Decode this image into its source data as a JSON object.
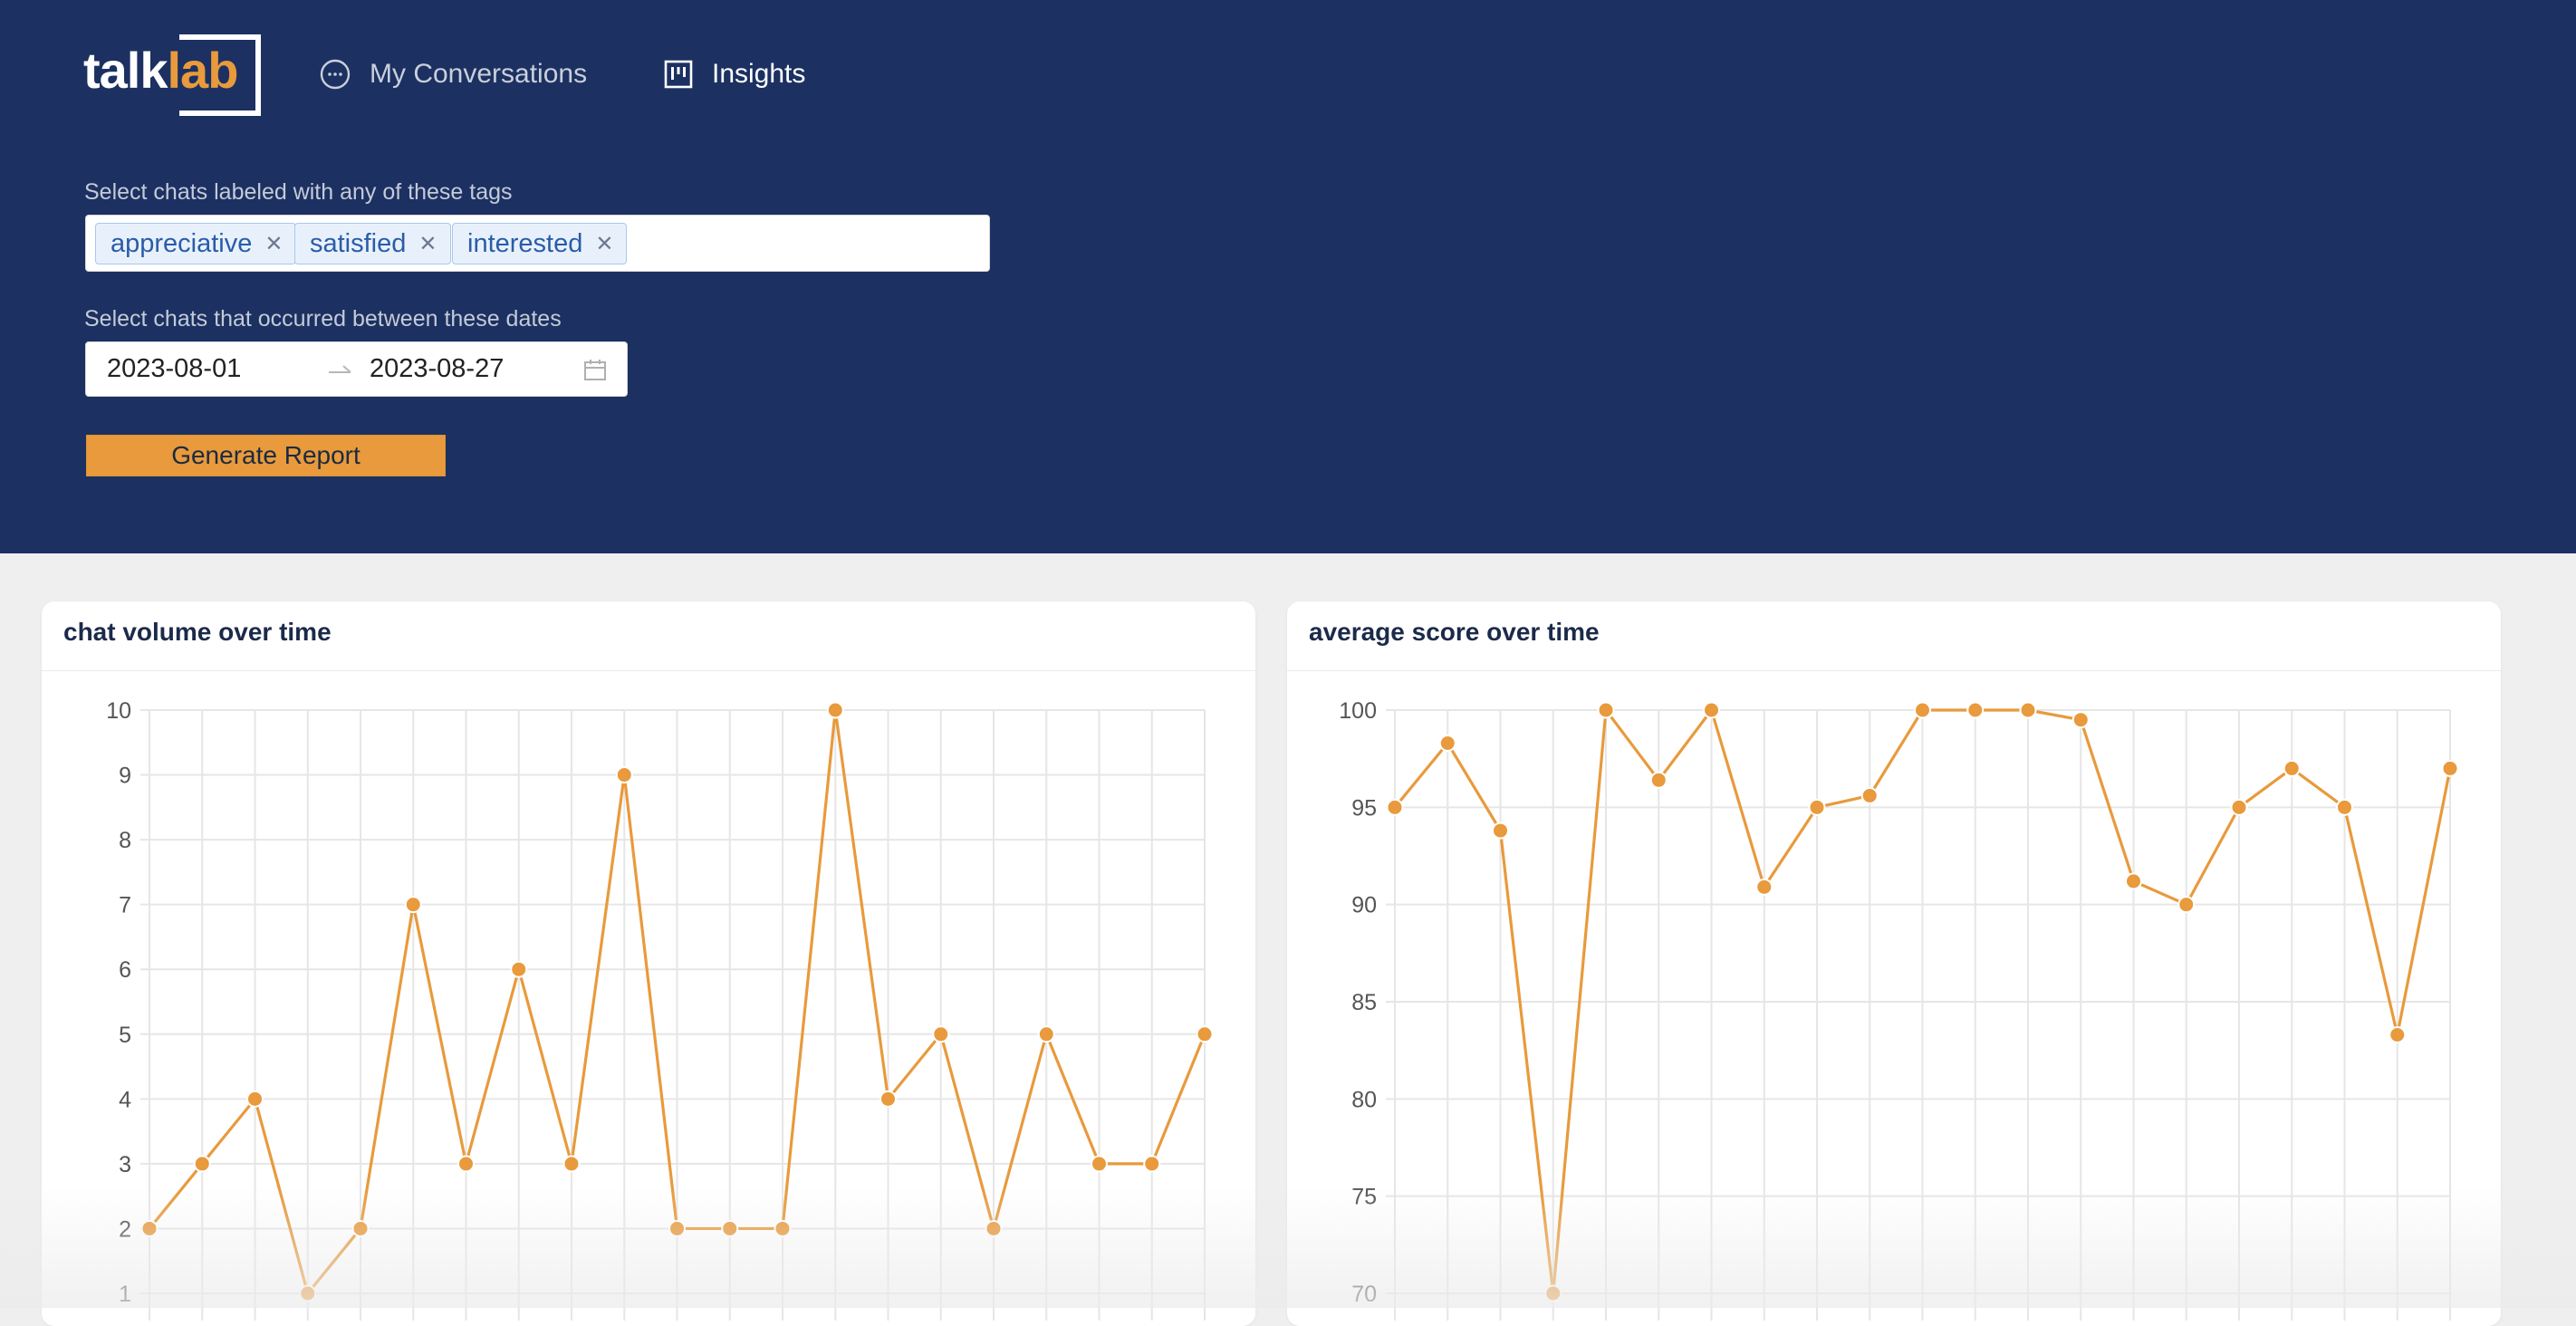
{
  "app": {
    "logo_talk": "talk",
    "logo_lab": "lab"
  },
  "nav": {
    "conversations": "My Conversations",
    "insights": "Insights"
  },
  "filters": {
    "tags_label": "Select chats labeled with any of these tags",
    "tags": [
      "appreciative",
      "satisfied",
      "interested"
    ],
    "dates_label": "Select chats that occurred between these dates",
    "start_date": "2023-08-01",
    "end_date": "2023-08-27",
    "generate_label": "Generate Report"
  },
  "colors": {
    "header_bg": "#1c3161",
    "accent": "#e89a3c",
    "tag_text": "#2a5ca8"
  },
  "chart_data": [
    {
      "type": "line",
      "title": "chat volume over time",
      "ylim": [
        1,
        10
      ],
      "yticks": [
        1,
        2,
        3,
        4,
        5,
        6,
        7,
        8,
        9,
        10
      ],
      "values": [
        2,
        3,
        4,
        1,
        2,
        7,
        3,
        6,
        3,
        9,
        2,
        2,
        2,
        10,
        4,
        5,
        2,
        5,
        3,
        3,
        5
      ],
      "grid": true,
      "color": "#e89a3c"
    },
    {
      "type": "line",
      "title": "average score over time",
      "ylim": [
        70,
        100
      ],
      "yticks": [
        70,
        75,
        80,
        85,
        90,
        95,
        100
      ],
      "values": [
        95,
        98.3,
        93.8,
        70,
        100,
        96.4,
        100,
        90.9,
        95,
        95.6,
        100,
        100,
        100,
        99.5,
        91.2,
        90,
        95,
        97,
        95,
        83.3,
        97
      ],
      "grid": true,
      "color": "#e89a3c"
    }
  ]
}
